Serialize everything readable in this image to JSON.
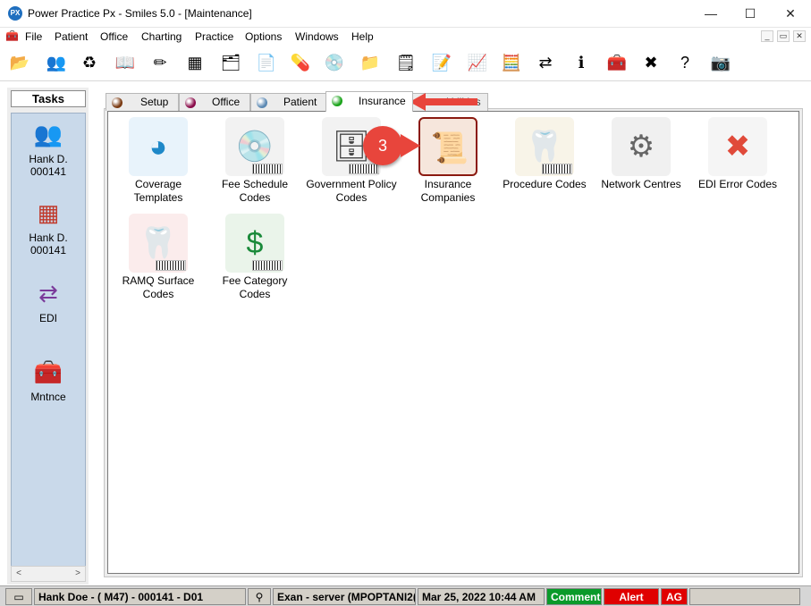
{
  "window": {
    "title": "Power Practice Px - Smiles 5.0 - [Maintenance]",
    "logo_text": "PX",
    "min_glyph": "—",
    "max_glyph": "☐",
    "close_glyph": "✕"
  },
  "menu": {
    "items": [
      "File",
      "Patient",
      "Office",
      "Charting",
      "Practice",
      "Options",
      "Windows",
      "Help"
    ],
    "mdi": [
      "_",
      "▭",
      "✕"
    ]
  },
  "toolbar": {
    "buttons": [
      {
        "name": "open-folder-icon",
        "glyph": "📂"
      },
      {
        "name": "patients-icon",
        "glyph": "👥"
      },
      {
        "name": "recall-icon",
        "glyph": "♻"
      },
      {
        "name": "book-icon",
        "glyph": "📖"
      },
      {
        "name": "pencil-chart-icon",
        "glyph": "✏"
      },
      {
        "name": "chart-icon",
        "glyph": "▦"
      },
      {
        "name": "appointment-icon",
        "glyph": "🗂"
      },
      {
        "name": "document-icon",
        "glyph": "📄"
      },
      {
        "name": "medical-icon",
        "glyph": "💊"
      },
      {
        "name": "image-icon",
        "glyph": "💿"
      },
      {
        "name": "folders-icon",
        "glyph": "📁"
      },
      {
        "name": "notepad-icon",
        "glyph": "🗒"
      },
      {
        "name": "notes-icon",
        "glyph": "📝"
      },
      {
        "name": "report-chart-icon",
        "glyph": "📈"
      },
      {
        "name": "calculator-icon",
        "glyph": "🧮"
      },
      {
        "name": "edi-icon",
        "glyph": "⇄"
      },
      {
        "name": "info-icon",
        "glyph": "ℹ"
      },
      {
        "name": "maintenance-box-icon",
        "glyph": "🧰"
      },
      {
        "name": "cancel-icon",
        "glyph": "✖"
      },
      {
        "name": "help-icon",
        "glyph": "?"
      },
      {
        "name": "camera-icon",
        "glyph": "📷"
      }
    ]
  },
  "tasks": {
    "title": "Tasks",
    "items": [
      {
        "name": "task-patient",
        "glyph": "👥",
        "label_1": "Hank D.",
        "label_2": "000141"
      },
      {
        "name": "task-chart",
        "glyph": "▦",
        "label_1": "Hank D.",
        "label_2": "000141"
      },
      {
        "name": "task-edi",
        "glyph": "⇄",
        "label_1": "EDI",
        "label_2": ""
      },
      {
        "name": "task-maintenance",
        "glyph": "🧰",
        "label_1": "Mntnce",
        "label_2": ""
      }
    ],
    "scroll_left": "<",
    "scroll_right": ">"
  },
  "tabs": [
    {
      "label": "Setup",
      "color": "#7a3a12"
    },
    {
      "label": "Office",
      "color": "#8a0c4a"
    },
    {
      "label": "Patient",
      "color": "#5c89b3"
    },
    {
      "label": "Insurance",
      "color": "#1aa31a"
    },
    {
      "label": "Utilities",
      "color": "#8a8a8a"
    }
  ],
  "grid": [
    {
      "name": "coverage-templates",
      "glyph": "◕",
      "bg": "#e8f3fb",
      "color": "#1e88c8",
      "line1": "Coverage",
      "line2": "Templates",
      "barcode": false
    },
    {
      "name": "fee-schedule-codes",
      "glyph": "💿",
      "bg": "#f2f2f2",
      "color": "#888",
      "line1": "Fee Schedule",
      "line2": "Codes",
      "barcode": true
    },
    {
      "name": "government-policy-codes",
      "glyph": "🗄",
      "bg": "#f2f2f2",
      "color": "#444",
      "line1": "Government Policy",
      "line2": "Codes",
      "barcode": true
    },
    {
      "name": "insurance-companies",
      "glyph": "📜",
      "bg": "#f6e6dc",
      "color": "#b3261e",
      "line1": "Insurance",
      "line2": "Companies",
      "barcode": false
    },
    {
      "name": "procedure-codes",
      "glyph": "🦷",
      "bg": "#f8f4e8",
      "color": "#c88a00",
      "line1": "Procedure Codes",
      "line2": "",
      "barcode": true
    },
    {
      "name": "network-centres",
      "glyph": "⚙",
      "bg": "#f0f0f0",
      "color": "#666",
      "line1": "Network Centres",
      "line2": "",
      "barcode": false
    },
    {
      "name": "edi-error-codes",
      "glyph": "✖",
      "bg": "#f5f5f5",
      "color": "#e04a3a",
      "line1": "EDI Error Codes",
      "line2": "",
      "barcode": false
    },
    {
      "name": "ramq-surface-codes",
      "glyph": "🦷",
      "bg": "#fbecec",
      "color": "#c01818",
      "line1": "RAMQ Surface",
      "line2": "Codes",
      "barcode": true
    },
    {
      "name": "fee-category-codes",
      "glyph": "$",
      "bg": "#eaf4ea",
      "color": "#1a8a3a",
      "line1": "Fee Category",
      "line2": "Codes",
      "barcode": true
    }
  ],
  "annotation": {
    "step_number": "3"
  },
  "status": {
    "icon": "▭",
    "patient": "Hank Doe - ( M47) - 000141 - D01",
    "exan_icon": "⚲",
    "server": "Exan - server (MPOPTANI2(",
    "datetime": "Mar 25, 2022 10:44 AM",
    "comment": "Comment",
    "alert": "Alert",
    "ag": "AG",
    "comment_color": "#0a9a2a",
    "alert_color": "#e00000"
  }
}
